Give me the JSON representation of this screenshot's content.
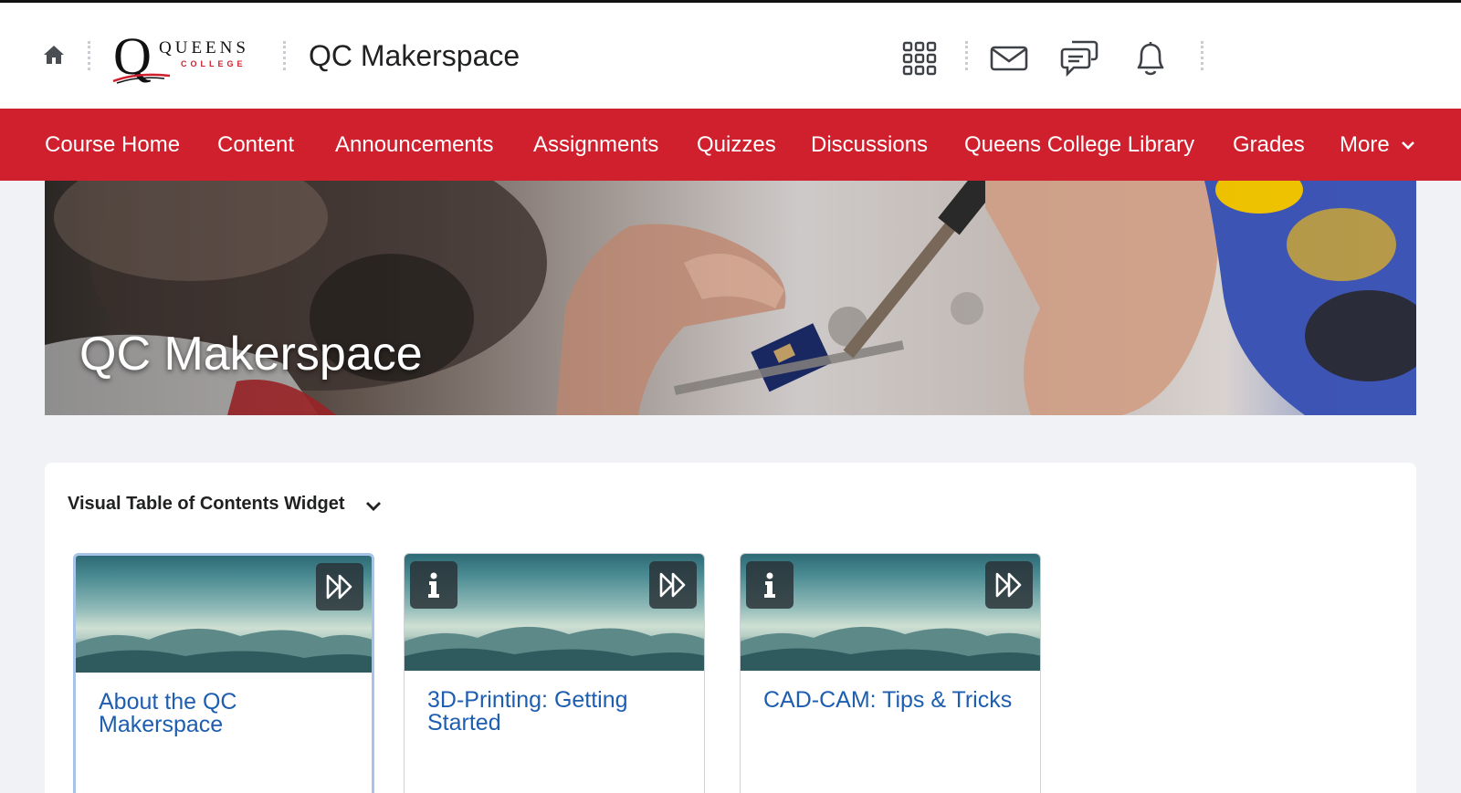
{
  "header": {
    "course_title": "QC Makerspace",
    "logo_text": "QUEENS",
    "logo_subtext": "COLLEGE",
    "icons": [
      "home-icon",
      "app-grid-icon",
      "mail-icon",
      "chat-icon",
      "bell-icon"
    ]
  },
  "nav": {
    "items": [
      {
        "label": "Course Home"
      },
      {
        "label": "Content"
      },
      {
        "label": "Announcements"
      },
      {
        "label": "Assignments"
      },
      {
        "label": "Quizzes"
      },
      {
        "label": "Discussions"
      },
      {
        "label": "Queens College Library"
      },
      {
        "label": "Grades"
      },
      {
        "label": "More"
      }
    ]
  },
  "banner": {
    "title": "QC Makerspace"
  },
  "widget": {
    "title": "Visual Table of Contents Widget",
    "cards": [
      {
        "title": "About the QC Makerspace",
        "has_info": false
      },
      {
        "title": "3D-Printing: Getting Started",
        "has_info": true
      },
      {
        "title": "CAD-CAM: Tips & Tricks",
        "has_info": true
      }
    ]
  },
  "colors": {
    "nav_red": "#d0202e",
    "link_blue": "#1d5eb0",
    "selected_border": "#a7c3e8"
  }
}
